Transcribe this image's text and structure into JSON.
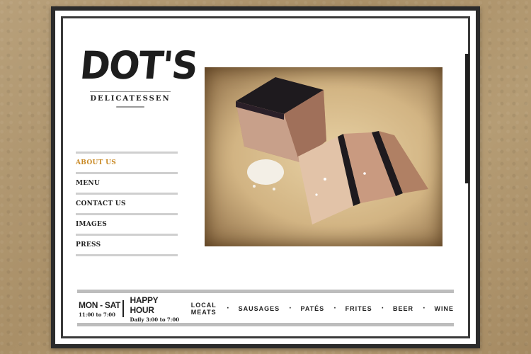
{
  "brand": {
    "name": "DOT'S",
    "subtitle": "DELICATESSEN"
  },
  "nav": {
    "items": [
      {
        "label": "ABOUT US",
        "active": true
      },
      {
        "label": "MENU"
      },
      {
        "label": "CONTACT US"
      },
      {
        "label": "IMAGES"
      },
      {
        "label": "PRESS"
      }
    ],
    "active_color": "#c98a26"
  },
  "footer": {
    "hours_title": "MON - SAT",
    "hours_time": "11:00 to 7:00",
    "happy_title": "HAPPY HOUR",
    "happy_time": "Daily 3:00 to 7:00",
    "tags": [
      "LOCAL MEATS",
      "SAUSAGES",
      "PATÉS",
      "FRITES",
      "BEER",
      "WINE"
    ]
  },
  "colors": {
    "frame": "#2b2b2b",
    "background": "#b39a72",
    "rule": "#bdbdbd"
  }
}
